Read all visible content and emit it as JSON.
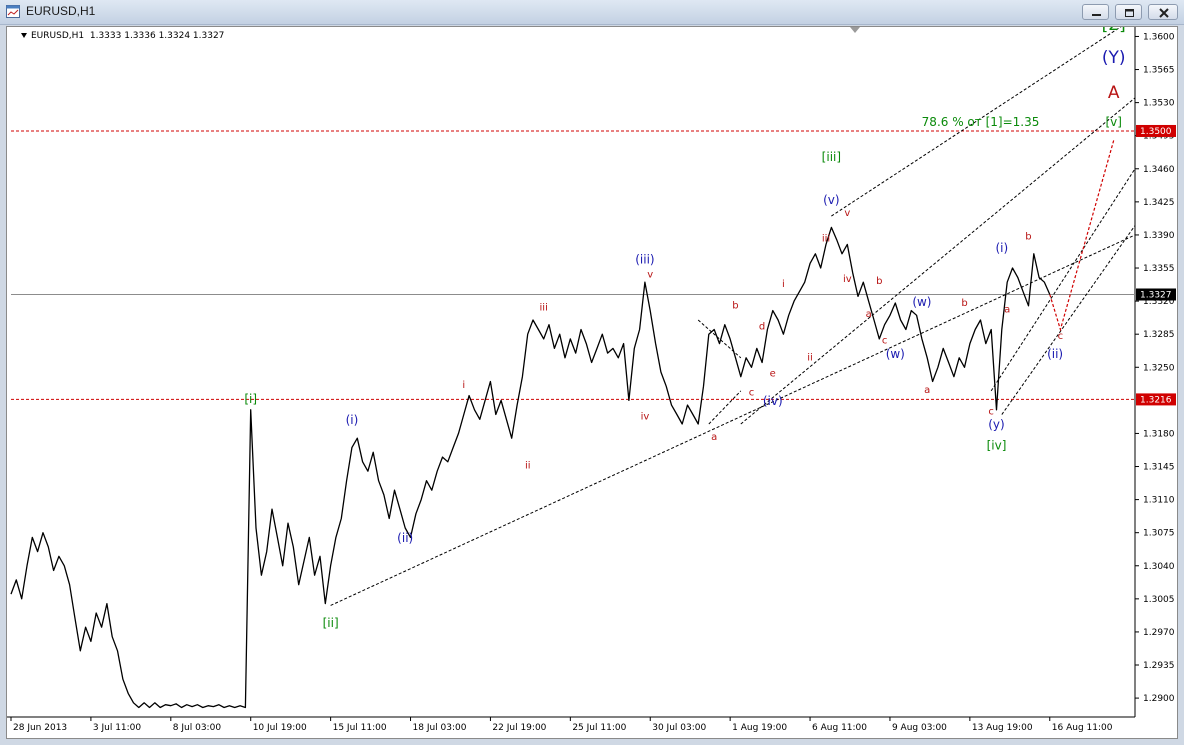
{
  "window": {
    "title": "EURUSD,H1",
    "buttons": {
      "minimize": "minimize-icon",
      "maximize": "maximize-icon",
      "close": "close-icon"
    }
  },
  "header": {
    "symbol": "EURUSD,H1",
    "prices": "1.3333 1.3336 1.3324 1.3327"
  },
  "colors": {
    "price": "#000000",
    "level": "#d00000",
    "wave_green": "#0a8a0a",
    "wave_blue": "#1a1ab0",
    "wave_red": "#b81414",
    "grid": "#8c8c8c",
    "current": "#8c8c8c"
  },
  "chart_data": {
    "type": "line",
    "title": "",
    "xlabel": "",
    "ylabel": "",
    "ylim": [
      1.288,
      1.361
    ],
    "grid": false,
    "y_ticks": [
      "1.3600",
      "1.3565",
      "1.3530",
      "1.3495",
      "1.3460",
      "1.3425",
      "1.3390",
      "1.3355",
      "1.3320",
      "1.3285",
      "1.3250",
      "1.3180",
      "1.3145",
      "1.3110",
      "1.3075",
      "1.3040",
      "1.3005",
      "1.2970",
      "1.2935",
      "1.2900"
    ],
    "x_ticks": [
      {
        "label": "28 Jun 2013",
        "x": 0
      },
      {
        "label": "3 Jul 11:00",
        "x": 15
      },
      {
        "label": "8 Jul 03:00",
        "x": 30
      },
      {
        "label": "10 Jul 19:00",
        "x": 45
      },
      {
        "label": "15 Jul 11:00",
        "x": 60
      },
      {
        "label": "18 Jul 03:00",
        "x": 75
      },
      {
        "label": "22 Jul 19:00",
        "x": 90
      },
      {
        "label": "25 Jul 11:00",
        "x": 105
      },
      {
        "label": "30 Jul 03:00",
        "x": 120
      },
      {
        "label": "1 Aug 19:00",
        "x": 135
      },
      {
        "label": "6 Aug 11:00",
        "x": 150
      },
      {
        "label": "9 Aug 03:00",
        "x": 165
      },
      {
        "label": "13 Aug 19:00",
        "x": 180
      },
      {
        "label": "16 Aug 11:00",
        "x": 195
      }
    ],
    "x_range": [
      0,
      211
    ],
    "price_path": [
      [
        0,
        1.301
      ],
      [
        1,
        1.3025
      ],
      [
        2,
        1.3005
      ],
      [
        3,
        1.304
      ],
      [
        4,
        1.307
      ],
      [
        5,
        1.3055
      ],
      [
        6,
        1.3075
      ],
      [
        7,
        1.306
      ],
      [
        8,
        1.3035
      ],
      [
        9,
        1.305
      ],
      [
        10,
        1.304
      ],
      [
        11,
        1.302
      ],
      [
        12,
        1.2985
      ],
      [
        13,
        1.295
      ],
      [
        14,
        1.2975
      ],
      [
        15,
        1.296
      ],
      [
        16,
        1.299
      ],
      [
        17,
        1.2975
      ],
      [
        18,
        1.3
      ],
      [
        19,
        1.2965
      ],
      [
        20,
        1.295
      ],
      [
        21,
        1.292
      ],
      [
        22,
        1.2905
      ],
      [
        23,
        1.2895
      ],
      [
        24,
        1.289
      ],
      [
        25,
        1.2895
      ],
      [
        26,
        1.289
      ],
      [
        27,
        1.2895
      ],
      [
        28,
        1.289
      ],
      [
        29,
        1.2893
      ],
      [
        30,
        1.2892
      ],
      [
        31,
        1.2894
      ],
      [
        32,
        1.289
      ],
      [
        33,
        1.2893
      ],
      [
        34,
        1.2891
      ],
      [
        35,
        1.2893
      ],
      [
        36,
        1.289
      ],
      [
        37,
        1.2892
      ],
      [
        38,
        1.2891
      ],
      [
        39,
        1.2893
      ],
      [
        40,
        1.289
      ],
      [
        41,
        1.2892
      ],
      [
        42,
        1.289
      ],
      [
        43,
        1.2892
      ],
      [
        44,
        1.289
      ],
      [
        45,
        1.3205
      ],
      [
        46,
        1.308
      ],
      [
        47,
        1.303
      ],
      [
        48,
        1.3055
      ],
      [
        49,
        1.31
      ],
      [
        50,
        1.307
      ],
      [
        51,
        1.304
      ],
      [
        52,
        1.3085
      ],
      [
        53,
        1.306
      ],
      [
        54,
        1.302
      ],
      [
        55,
        1.3045
      ],
      [
        56,
        1.307
      ],
      [
        57,
        1.303
      ],
      [
        58,
        1.305
      ],
      [
        59,
        1.3
      ],
      [
        60,
        1.304
      ],
      [
        61,
        1.307
      ],
      [
        62,
        1.309
      ],
      [
        63,
        1.313
      ],
      [
        64,
        1.3165
      ],
      [
        65,
        1.3175
      ],
      [
        66,
        1.315
      ],
      [
        67,
        1.314
      ],
      [
        68,
        1.316
      ],
      [
        69,
        1.313
      ],
      [
        70,
        1.3115
      ],
      [
        71,
        1.309
      ],
      [
        72,
        1.312
      ],
      [
        73,
        1.31
      ],
      [
        74,
        1.308
      ],
      [
        75,
        1.307
      ],
      [
        76,
        1.3095
      ],
      [
        77,
        1.311
      ],
      [
        78,
        1.313
      ],
      [
        79,
        1.312
      ],
      [
        80,
        1.314
      ],
      [
        81,
        1.3155
      ],
      [
        82,
        1.315
      ],
      [
        83,
        1.3165
      ],
      [
        84,
        1.318
      ],
      [
        85,
        1.32
      ],
      [
        86,
        1.322
      ],
      [
        87,
        1.3205
      ],
      [
        88,
        1.3195
      ],
      [
        89,
        1.3215
      ],
      [
        90,
        1.3235
      ],
      [
        91,
        1.32
      ],
      [
        92,
        1.3215
      ],
      [
        93,
        1.3195
      ],
      [
        94,
        1.3175
      ],
      [
        95,
        1.321
      ],
      [
        96,
        1.324
      ],
      [
        97,
        1.3285
      ],
      [
        98,
        1.33
      ],
      [
        99,
        1.329
      ],
      [
        100,
        1.328
      ],
      [
        101,
        1.3295
      ],
      [
        102,
        1.327
      ],
      [
        103,
        1.3285
      ],
      [
        104,
        1.326
      ],
      [
        105,
        1.328
      ],
      [
        106,
        1.3265
      ],
      [
        107,
        1.329
      ],
      [
        108,
        1.3275
      ],
      [
        109,
        1.3255
      ],
      [
        110,
        1.327
      ],
      [
        111,
        1.3285
      ],
      [
        112,
        1.3265
      ],
      [
        113,
        1.327
      ],
      [
        114,
        1.326
      ],
      [
        115,
        1.3275
      ],
      [
        116,
        1.3215
      ],
      [
        117,
        1.327
      ],
      [
        118,
        1.329
      ],
      [
        119,
        1.334
      ],
      [
        120,
        1.331
      ],
      [
        121,
        1.3275
      ],
      [
        122,
        1.3245
      ],
      [
        123,
        1.323
      ],
      [
        124,
        1.321
      ],
      [
        125,
        1.32
      ],
      [
        126,
        1.319
      ],
      [
        127,
        1.321
      ],
      [
        128,
        1.32
      ],
      [
        129,
        1.319
      ],
      [
        130,
        1.323
      ],
      [
        131,
        1.3285
      ],
      [
        132,
        1.329
      ],
      [
        133,
        1.3275
      ],
      [
        134,
        1.3295
      ],
      [
        135,
        1.328
      ],
      [
        136,
        1.326
      ],
      [
        137,
        1.324
      ],
      [
        138,
        1.326
      ],
      [
        139,
        1.325
      ],
      [
        140,
        1.327
      ],
      [
        141,
        1.3255
      ],
      [
        142,
        1.329
      ],
      [
        143,
        1.331
      ],
      [
        144,
        1.33
      ],
      [
        145,
        1.3285
      ],
      [
        146,
        1.3305
      ],
      [
        147,
        1.332
      ],
      [
        148,
        1.333
      ],
      [
        149,
        1.334
      ],
      [
        150,
        1.336
      ],
      [
        151,
        1.337
      ],
      [
        152,
        1.3355
      ],
      [
        153,
        1.338
      ],
      [
        154,
        1.3398
      ],
      [
        155,
        1.3385
      ],
      [
        156,
        1.337
      ],
      [
        157,
        1.338
      ],
      [
        158,
        1.335
      ],
      [
        159,
        1.3325
      ],
      [
        160,
        1.334
      ],
      [
        161,
        1.332
      ],
      [
        162,
        1.33
      ],
      [
        163,
        1.328
      ],
      [
        164,
        1.3295
      ],
      [
        165,
        1.3305
      ],
      [
        166,
        1.3318
      ],
      [
        167,
        1.33
      ],
      [
        168,
        1.329
      ],
      [
        169,
        1.331
      ],
      [
        170,
        1.3305
      ],
      [
        171,
        1.328
      ],
      [
        172,
        1.326
      ],
      [
        173,
        1.3235
      ],
      [
        174,
        1.325
      ],
      [
        175,
        1.327
      ],
      [
        176,
        1.3255
      ],
      [
        177,
        1.324
      ],
      [
        178,
        1.326
      ],
      [
        179,
        1.325
      ],
      [
        180,
        1.3275
      ],
      [
        181,
        1.329
      ],
      [
        182,
        1.33
      ],
      [
        183,
        1.3275
      ],
      [
        184,
        1.329
      ],
      [
        185,
        1.3205
      ],
      [
        186,
        1.329
      ],
      [
        187,
        1.334
      ],
      [
        188,
        1.3355
      ],
      [
        189,
        1.3345
      ],
      [
        190,
        1.333
      ],
      [
        191,
        1.3315
      ],
      [
        192,
        1.337
      ],
      [
        193,
        1.3345
      ],
      [
        194,
        1.334
      ],
      [
        195,
        1.3327
      ]
    ],
    "projection": [
      [
        195,
        1.3327
      ],
      [
        197,
        1.329
      ],
      [
        207,
        1.349
      ]
    ],
    "levels": [
      {
        "price": 1.35,
        "label": "1.3500"
      },
      {
        "price": 1.3216,
        "label": "1.3216"
      }
    ],
    "current_price": {
      "price": 1.3327,
      "label": "1.3327"
    },
    "channel_lines": [
      [
        [
          60,
          1.2998
        ],
        [
          211,
          1.339
        ]
      ],
      [
        [
          137,
          1.319
        ],
        [
          211,
          1.3535
        ]
      ],
      [
        [
          154,
          1.341
        ],
        [
          211,
          1.362
        ]
      ],
      [
        [
          184,
          1.3225
        ],
        [
          211,
          1.346
        ]
      ],
      [
        [
          186,
          1.32
        ],
        [
          211,
          1.34
        ]
      ],
      [
        [
          129,
          1.33
        ],
        [
          137,
          1.326
        ]
      ],
      [
        [
          131,
          1.319
        ],
        [
          137,
          1.3225
        ]
      ]
    ],
    "annotations": [
      {
        "text": "[i]",
        "x": 45,
        "y": 1.3212,
        "color": "green",
        "size": 12
      },
      {
        "text": "[ii]",
        "x": 60,
        "y": 1.2975,
        "color": "green",
        "size": 12
      },
      {
        "text": "[iii]",
        "x": 154,
        "y": 1.3468,
        "color": "green",
        "size": 12
      },
      {
        "text": "[iv]",
        "x": 185,
        "y": 1.3163,
        "color": "green",
        "size": 12
      },
      {
        "text": "[v]",
        "x": 207,
        "y": 1.3505,
        "color": "green",
        "size": 12
      },
      {
        "text": "[2]",
        "x": 207,
        "y": 1.3607,
        "color": "green",
        "size": 17
      },
      {
        "text": "(Y)",
        "x": 207,
        "y": 1.3572,
        "color": "blue",
        "size": 17
      },
      {
        "text": "A",
        "x": 207,
        "y": 1.3535,
        "color": "red",
        "size": 17
      },
      {
        "text": "78.6 % от [1]=1.35",
        "x": 182,
        "y": 1.3505,
        "color": "green",
        "size": 12
      },
      {
        "text": "(i)",
        "x": 64,
        "y": 1.319,
        "color": "blue",
        "size": 12
      },
      {
        "text": "(ii)",
        "x": 74,
        "y": 1.3065,
        "color": "blue",
        "size": 12
      },
      {
        "text": "(iii)",
        "x": 119,
        "y": 1.336,
        "color": "blue",
        "size": 12
      },
      {
        "text": "(iv)",
        "x": 143,
        "y": 1.321,
        "color": "blue",
        "size": 12
      },
      {
        "text": "(v)",
        "x": 154,
        "y": 1.3423,
        "color": "blue",
        "size": 12
      },
      {
        "text": "(w)",
        "x": 166,
        "y": 1.326,
        "color": "blue",
        "size": 12
      },
      {
        "text": "(w)",
        "x": 171,
        "y": 1.3315,
        "color": "blue",
        "size": 12
      },
      {
        "text": "(y)",
        "x": 185,
        "y": 1.3185,
        "color": "blue",
        "size": 12
      },
      {
        "text": "(i)",
        "x": 186,
        "y": 1.3372,
        "color": "blue",
        "size": 12
      },
      {
        "text": "(ii)",
        "x": 196,
        "y": 1.326,
        "color": "blue",
        "size": 12
      },
      {
        "text": "i",
        "x": 85,
        "y": 1.3228,
        "color": "red",
        "size": 10
      },
      {
        "text": "ii",
        "x": 97,
        "y": 1.3143,
        "color": "red",
        "size": 10
      },
      {
        "text": "iii",
        "x": 100,
        "y": 1.331,
        "color": "red",
        "size": 10
      },
      {
        "text": "iv",
        "x": 119,
        "y": 1.3195,
        "color": "red",
        "size": 10
      },
      {
        "text": "v",
        "x": 120,
        "y": 1.3345,
        "color": "red",
        "size": 10
      },
      {
        "text": "a",
        "x": 132,
        "y": 1.3173,
        "color": "red",
        "size": 10
      },
      {
        "text": "b",
        "x": 136,
        "y": 1.3312,
        "color": "red",
        "size": 10
      },
      {
        "text": "c",
        "x": 139,
        "y": 1.322,
        "color": "red",
        "size": 10
      },
      {
        "text": "d",
        "x": 141,
        "y": 1.329,
        "color": "red",
        "size": 10
      },
      {
        "text": "e",
        "x": 143,
        "y": 1.324,
        "color": "red",
        "size": 10
      },
      {
        "text": "i",
        "x": 145,
        "y": 1.3335,
        "color": "red",
        "size": 10
      },
      {
        "text": "ii",
        "x": 150,
        "y": 1.3257,
        "color": "red",
        "size": 10
      },
      {
        "text": "iii",
        "x": 153,
        "y": 1.3383,
        "color": "red",
        "size": 10
      },
      {
        "text": "iv",
        "x": 157,
        "y": 1.334,
        "color": "red",
        "size": 10
      },
      {
        "text": "v",
        "x": 157,
        "y": 1.341,
        "color": "red",
        "size": 10
      },
      {
        "text": "a",
        "x": 161,
        "y": 1.3303,
        "color": "red",
        "size": 10
      },
      {
        "text": "b",
        "x": 163,
        "y": 1.3338,
        "color": "red",
        "size": 10
      },
      {
        "text": "c",
        "x": 164,
        "y": 1.3275,
        "color": "red",
        "size": 10
      },
      {
        "text": "a",
        "x": 172,
        "y": 1.3223,
        "color": "red",
        "size": 10
      },
      {
        "text": "b",
        "x": 179,
        "y": 1.3315,
        "color": "red",
        "size": 10
      },
      {
        "text": "c",
        "x": 184,
        "y": 1.32,
        "color": "red",
        "size": 10
      },
      {
        "text": "a",
        "x": 187,
        "y": 1.3308,
        "color": "red",
        "size": 10
      },
      {
        "text": "b",
        "x": 191,
        "y": 1.3385,
        "color": "red",
        "size": 10
      },
      {
        "text": "c",
        "x": 197,
        "y": 1.328,
        "color": "red",
        "size": 10
      }
    ]
  }
}
